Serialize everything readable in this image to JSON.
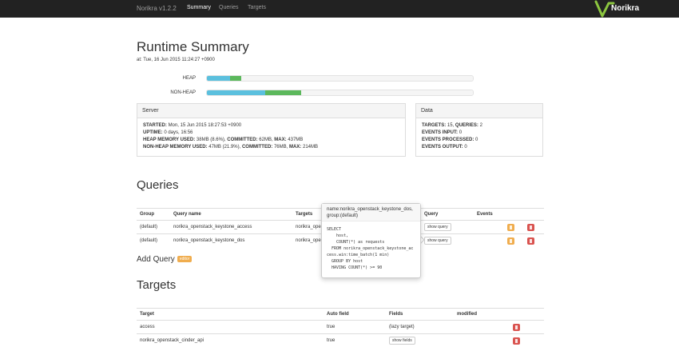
{
  "navbar": {
    "brand": "Norikra v1.2.2",
    "links": [
      {
        "label": "Summary",
        "active": true
      },
      {
        "label": "Queries",
        "active": false
      },
      {
        "label": "Targets",
        "active": false
      }
    ],
    "logo_text": "Norikra"
  },
  "summary": {
    "title": "Runtime Summary",
    "timestamp": "at: Tue, 16 Jun 2015 11:24:27 +0900",
    "heap": {
      "label": "HEAP",
      "used_pct": 8.6,
      "committed_pct": 13.0
    },
    "nonheap": {
      "label": "NON-HEAP",
      "used_pct": 21.9,
      "committed_pct": 35.5
    }
  },
  "server_panel": {
    "heading": "Server",
    "started_label": "STARTED:",
    "started_value": "Mon, 15 Jun 2015 18:27:53 +0900",
    "uptime_label": "UPTIME:",
    "uptime_value": "0 days, 16:56",
    "heap_label": "HEAP MEMORY USED:",
    "heap_used": "38MB (8.6%),",
    "committed_label": "COMMITTED:",
    "heap_committed": "62MB,",
    "max_label": "MAX:",
    "heap_max": "437MB",
    "nonheap_label": "NON-HEAP MEMORY USED:",
    "nonheap_used": "47MB (21.9%),",
    "nonheap_committed": "76MB,",
    "nonheap_max": "214MB"
  },
  "data_panel": {
    "heading": "Data",
    "targets_label": "TARGETS:",
    "targets_value": "15,",
    "queries_label": "QUERIES:",
    "queries_value": "2",
    "events_input_label": "EVENTS INPUT:",
    "events_input_value": "0",
    "events_processed_label": "EVENTS PROCESSED:",
    "events_processed_value": "0",
    "events_output_label": "EVENTS OUTPUT:",
    "events_output_value": "0"
  },
  "queries": {
    "title": "Queries",
    "columns": [
      "Group",
      "Query name",
      "Targets",
      "",
      "Query",
      "Events",
      "",
      ""
    ],
    "rows": [
      {
        "group": "(default)",
        "name": "norikra_openstack_keystone_access",
        "target": "norikra_openstack_keystone_access",
        "button": "show query"
      },
      {
        "group": "(default)",
        "name": "norikra_openstack_keystone_dos",
        "target": "norikra_openstack_keystone_access",
        "button": "show query"
      }
    ],
    "add_label": "Add Query",
    "editor_badge": "editor",
    "popover": {
      "title": "name:norikra_openstack_keystone_dos, group:(default)",
      "sql": "SELECT\n    host,\n    COUNT(*) as requests\n  FROM norikra_openstack_keystone_ac\ncess.win:time_batch(1 min)\n  GROUP BY host\n  HAVING COUNT(*) >= 90"
    }
  },
  "targets": {
    "title": "Targets",
    "columns": [
      "Target",
      "Auto field",
      "Fields",
      "modified",
      ""
    ],
    "rows": [
      {
        "name": "access",
        "auto": "true",
        "fields": "(lazy target)",
        "fields_button": false
      },
      {
        "name": "norikra_openstack_cinder_api",
        "auto": "true",
        "fields": "show fields",
        "fields_button": true
      }
    ]
  },
  "colors": {
    "navbar": "#222222",
    "used": "#5bc0de",
    "committed": "#5cb85c",
    "warning": "#f0ad4e",
    "danger": "#d9534f"
  }
}
